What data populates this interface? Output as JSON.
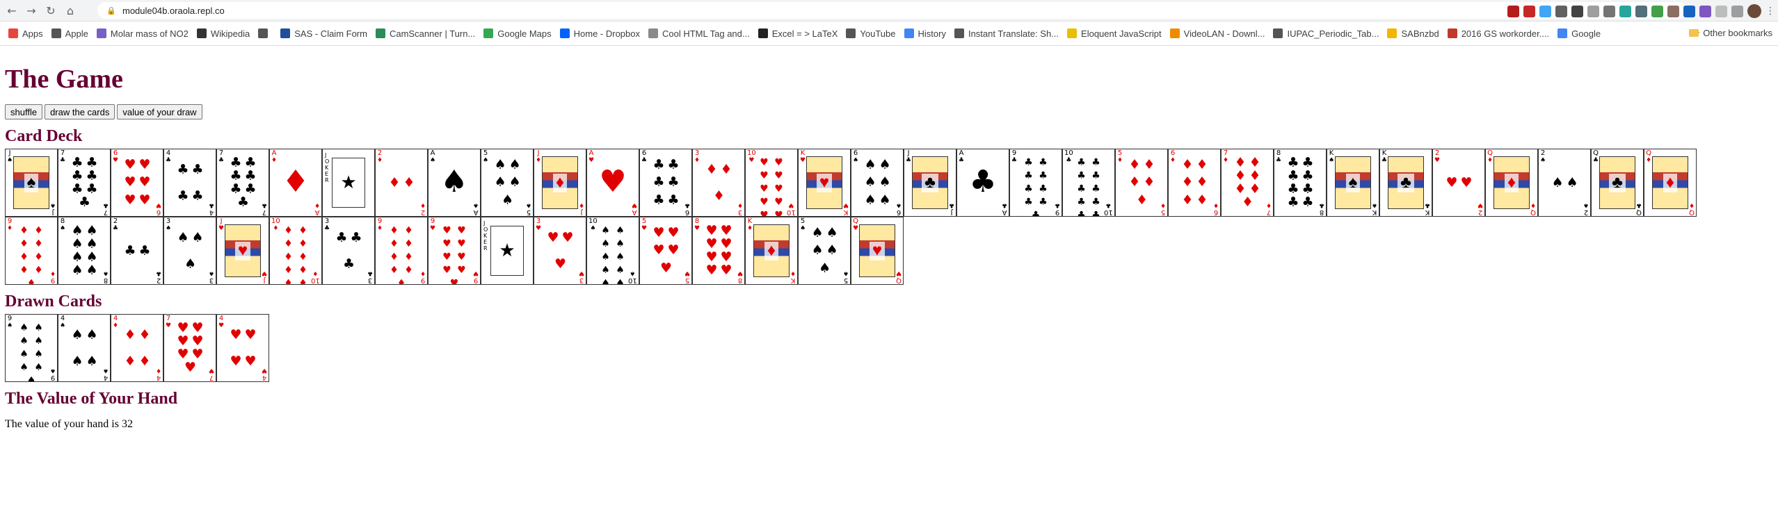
{
  "browser": {
    "url": "module04b.oraola.repl.co",
    "bookmarks": [
      {
        "label": "Apps",
        "color": "#e8453c"
      },
      {
        "label": "Apple",
        "color": "#555555"
      },
      {
        "label": "Molar mass of NO2",
        "color": "#7a5ec7"
      },
      {
        "label": "Wikipedia",
        "color": "#333333"
      },
      {
        "label": "",
        "color": "#555555"
      },
      {
        "label": "SAS - Claim Form",
        "color": "#1f4e9c"
      },
      {
        "label": "CamScanner | Turn...",
        "color": "#2a8c58"
      },
      {
        "label": "Google Maps",
        "color": "#34a853"
      },
      {
        "label": "Home - Dropbox",
        "color": "#0061fe"
      },
      {
        "label": "Cool HTML Tag and...",
        "color": "#8a8a8a"
      },
      {
        "label": "Excel = > LaTeX",
        "color": "#222222"
      },
      {
        "label": "YouTube",
        "color": "#555555"
      },
      {
        "label": "History",
        "color": "#4285f4"
      },
      {
        "label": "Instant Translate: Sh...",
        "color": "#555555"
      },
      {
        "label": "Eloquent JavaScript",
        "color": "#e8c000"
      },
      {
        "label": "VideoLAN - Downl...",
        "color": "#f08a00"
      },
      {
        "label": "IUPAC_Periodic_Tab...",
        "color": "#555555"
      },
      {
        "label": "SABnzbd",
        "color": "#f2b600"
      },
      {
        "label": "2016 GS workorder....",
        "color": "#c0392b"
      },
      {
        "label": "Google",
        "color": "#4285f4"
      }
    ],
    "other_bookmarks": "Other bookmarks"
  },
  "page": {
    "title": "The Game",
    "buttons": {
      "shuffle": "shuffle",
      "draw": "draw the cards",
      "value": "value of your draw"
    },
    "deck_heading": "Card Deck",
    "drawn_heading": "Drawn Cards",
    "value_heading": "The Value of Your Hand",
    "hand_value_text": "The value of your hand is 32"
  },
  "colors": {
    "heading": "#660033",
    "red": "#e00000",
    "black": "#000000"
  },
  "deck": [
    {
      "r": "J",
      "s": "♠"
    },
    {
      "r": "7",
      "s": "♣"
    },
    {
      "r": "6",
      "s": "♥"
    },
    {
      "r": "4",
      "s": "♣"
    },
    {
      "r": "7",
      "s": "♣"
    },
    {
      "r": "A",
      "s": "♦"
    },
    {
      "r": "JOKER",
      "s": "★"
    },
    {
      "r": "2",
      "s": "♦"
    },
    {
      "r": "A",
      "s": "♠"
    },
    {
      "r": "5",
      "s": "♠"
    },
    {
      "r": "J",
      "s": "♦"
    },
    {
      "r": "A",
      "s": "♥"
    },
    {
      "r": "6",
      "s": "♣"
    },
    {
      "r": "3",
      "s": "♦"
    },
    {
      "r": "10",
      "s": "♥"
    },
    {
      "r": "K",
      "s": "♥"
    },
    {
      "r": "6",
      "s": "♠"
    },
    {
      "r": "J",
      "s": "♣"
    },
    {
      "r": "A",
      "s": "♣"
    },
    {
      "r": "9",
      "s": "♣"
    },
    {
      "r": "10",
      "s": "♣"
    },
    {
      "r": "5",
      "s": "♦"
    },
    {
      "r": "6",
      "s": "♦"
    },
    {
      "r": "7",
      "s": "♦"
    },
    {
      "r": "8",
      "s": "♣"
    },
    {
      "r": "K",
      "s": "♠"
    },
    {
      "r": "K",
      "s": "♣"
    },
    {
      "r": "2",
      "s": "♥"
    },
    {
      "r": "Q",
      "s": "♦"
    },
    {
      "r": "2",
      "s": "♠"
    },
    {
      "r": "Q",
      "s": "♣"
    },
    {
      "r": "Q",
      "s": "♦"
    },
    {
      "r": "9",
      "s": "♦"
    },
    {
      "r": "8",
      "s": "♠"
    },
    {
      "r": "2",
      "s": "♣"
    },
    {
      "r": "3",
      "s": "♠"
    },
    {
      "r": "J",
      "s": "♥"
    },
    {
      "r": "10",
      "s": "♦"
    },
    {
      "r": "3",
      "s": "♣"
    },
    {
      "r": "9",
      "s": "♦"
    },
    {
      "r": "9",
      "s": "♥"
    },
    {
      "r": "JOKER",
      "s": "★"
    },
    {
      "r": "3",
      "s": "♥"
    },
    {
      "r": "10",
      "s": "♠"
    },
    {
      "r": "5",
      "s": "♥"
    },
    {
      "r": "8",
      "s": "♥"
    },
    {
      "r": "K",
      "s": "♦"
    },
    {
      "r": "5",
      "s": "♠"
    },
    {
      "r": "Q",
      "s": "♥"
    }
  ],
  "drawn": [
    {
      "r": "9",
      "s": "♠"
    },
    {
      "r": "4",
      "s": "♠"
    },
    {
      "r": "4",
      "s": "♦"
    },
    {
      "r": "7",
      "s": "♥"
    },
    {
      "r": "4",
      "s": "♥"
    }
  ]
}
